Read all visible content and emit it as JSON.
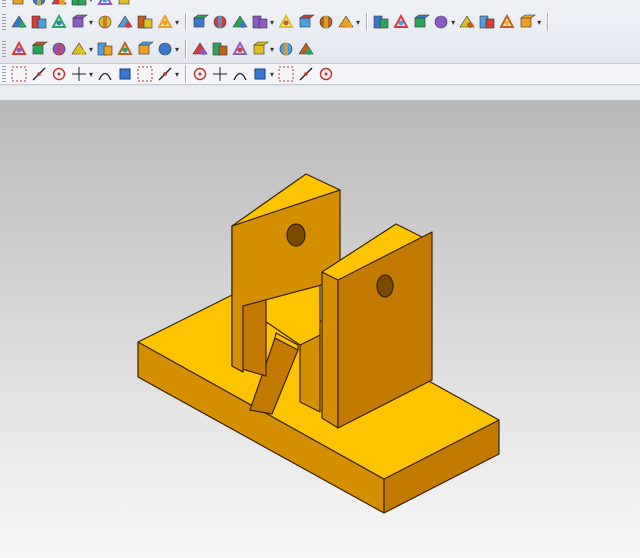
{
  "colors": {
    "model_top": "#ffc400",
    "model_front": "#d48f00",
    "model_side": "#c37a00",
    "edge": "#3a2200"
  },
  "toolbar_rows": [
    [
      "part-navigator-icon",
      "dropdown-arrow-icon",
      "sketch-icon",
      "undo-icon",
      "redo-icon",
      "render-mode-icon"
    ],
    [
      "sketch-icon",
      "extrude-icon",
      "revolve-icon",
      "sweep-icon",
      "tube-icon",
      "block-icon",
      "cylinder-icon",
      "cone-icon",
      "sphere-icon",
      "boolean-unite-icon",
      "boolean-subtract-icon",
      "face-blend-icon",
      "chamfer-icon",
      "shell-icon",
      "draft-icon",
      "feature-group-icon",
      "wave-link-icon",
      "mirror-body-icon",
      "pattern-icon",
      "offset-face-icon",
      "trim-body-icon",
      "split-body-icon",
      "sew-icon",
      "rotate-view-icon"
    ],
    [
      "hole-icon",
      "boss-icon",
      "pocket-icon",
      "pad-icon",
      "slot-icon",
      "groove-icon",
      "thread-icon",
      "datum-plane-icon",
      "datum-axis-icon",
      "analysis-icon",
      "measure-icon",
      "wireframe-icon",
      "shaded-icon",
      "csys-icon"
    ],
    [
      "select-all-icon",
      "undo-small-icon",
      "feature-filter-icon",
      "selection-box-icon",
      "snap-point-icon",
      "line-snap-icon",
      "curve-snap-icon",
      "arc-center-icon",
      "circle-snap-icon",
      "quadrant-icon",
      "intersection-icon",
      "endpoint-icon",
      "midpoint-icon",
      "tangent-icon",
      "view-icon"
    ]
  ]
}
